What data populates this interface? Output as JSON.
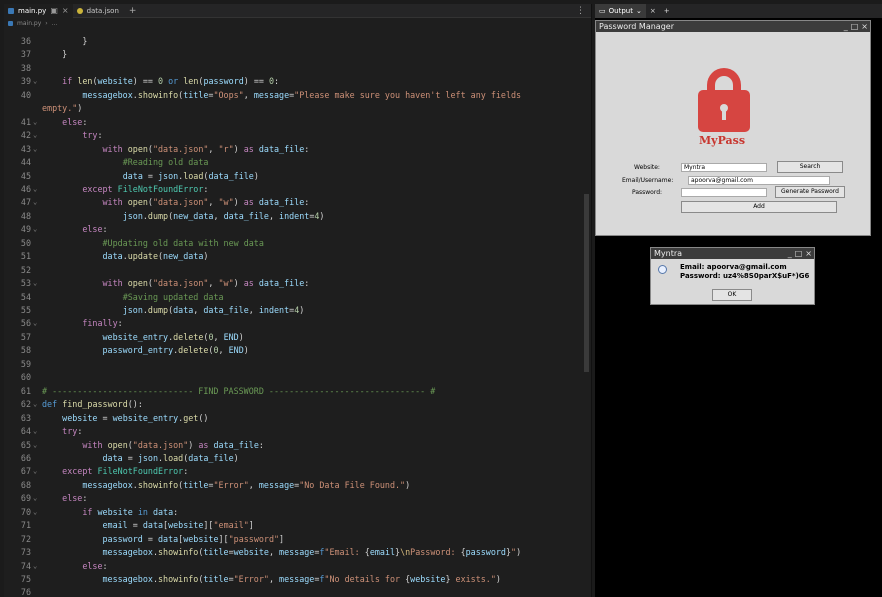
{
  "editor": {
    "tabs": [
      {
        "label": "main.py",
        "active": true
      },
      {
        "label": "data.json",
        "active": false
      }
    ],
    "breadcrumb": [
      "main.py",
      "..."
    ],
    "lines": [
      {
        "n": "36",
        "fold": false,
        "html": "        <span class='o'>}</span>"
      },
      {
        "n": "37",
        "fold": false,
        "html": "    <span class='o'>}</span>"
      },
      {
        "n": "38",
        "fold": false,
        "html": ""
      },
      {
        "n": "39",
        "fold": true,
        "html": "    <span class='kc'>if</span> <span class='f'>len</span>(<span class='v'>website</span>) == <span class='n'>0</span> <span class='k'>or</span> <span class='f'>len</span>(<span class='v'>password</span>) == <span class='n'>0</span>:"
      },
      {
        "n": "40",
        "fold": false,
        "html": "        <span class='v'>messagebox</span>.<span class='f'>showinfo</span>(<span class='v'>title</span>=<span class='s'>\"Oops\"</span>, <span class='v'>message</span>=<span class='s'>\"Please make sure you haven't left any fields</span>"
      },
      {
        "n": "",
        "fold": false,
        "html": "<span class='s'>empty.\"</span>)"
      },
      {
        "n": "41",
        "fold": true,
        "html": "    <span class='kc'>else</span>:"
      },
      {
        "n": "42",
        "fold": true,
        "html": "        <span class='kc'>try</span>:"
      },
      {
        "n": "43",
        "fold": true,
        "html": "            <span class='kc'>with</span> <span class='f'>open</span>(<span class='s'>\"data.json\"</span>, <span class='s'>\"r\"</span>) <span class='kc'>as</span> <span class='v'>data_file</span>:"
      },
      {
        "n": "44",
        "fold": false,
        "html": "                <span class='c'>#Reading old data</span>"
      },
      {
        "n": "45",
        "fold": false,
        "html": "                <span class='v'>data</span> = <span class='v'>json</span>.<span class='f'>load</span>(<span class='v'>data_file</span>)"
      },
      {
        "n": "46",
        "fold": true,
        "html": "        <span class='kc'>except</span> <span class='t'>FileNotFoundError</span>:"
      },
      {
        "n": "47",
        "fold": true,
        "html": "            <span class='kc'>with</span> <span class='f'>open</span>(<span class='s'>\"data.json\"</span>, <span class='s'>\"w\"</span>) <span class='kc'>as</span> <span class='v'>data_file</span>:"
      },
      {
        "n": "48",
        "fold": false,
        "html": "                <span class='v'>json</span>.<span class='f'>dump</span>(<span class='v'>new_data</span>, <span class='v'>data_file</span>, <span class='v'>indent</span>=<span class='n'>4</span>)"
      },
      {
        "n": "49",
        "fold": true,
        "html": "        <span class='kc'>else</span>:"
      },
      {
        "n": "50",
        "fold": false,
        "html": "            <span class='c'>#Updating old data with new data</span>"
      },
      {
        "n": "51",
        "fold": false,
        "html": "            <span class='v'>data</span>.<span class='f'>update</span>(<span class='v'>new_data</span>)"
      },
      {
        "n": "52",
        "fold": false,
        "html": ""
      },
      {
        "n": "53",
        "fold": true,
        "html": "            <span class='kc'>with</span> <span class='f'>open</span>(<span class='s'>\"data.json\"</span>, <span class='s'>\"w\"</span>) <span class='kc'>as</span> <span class='v'>data_file</span>:"
      },
      {
        "n": "54",
        "fold": false,
        "html": "                <span class='c'>#Saving updated data</span>"
      },
      {
        "n": "55",
        "fold": false,
        "html": "                <span class='v'>json</span>.<span class='f'>dump</span>(<span class='v'>data</span>, <span class='v'>data_file</span>, <span class='v'>indent</span>=<span class='n'>4</span>)"
      },
      {
        "n": "56",
        "fold": true,
        "html": "        <span class='kc'>finally</span>:"
      },
      {
        "n": "57",
        "fold": false,
        "html": "            <span class='v'>website_entry</span>.<span class='f'>delete</span>(<span class='n'>0</span>, <span class='v'>END</span>)"
      },
      {
        "n": "58",
        "fold": false,
        "html": "            <span class='v'>password_entry</span>.<span class='f'>delete</span>(<span class='n'>0</span>, <span class='v'>END</span>)"
      },
      {
        "n": "59",
        "fold": false,
        "html": ""
      },
      {
        "n": "60",
        "fold": false,
        "html": ""
      },
      {
        "n": "61",
        "fold": false,
        "html": "<span class='c'># ---------------------------- FIND PASSWORD ------------------------------- #</span>"
      },
      {
        "n": "62",
        "fold": true,
        "html": "<span class='k'>def</span> <span class='f'>find_password</span>():"
      },
      {
        "n": "63",
        "fold": false,
        "html": "    <span class='v'>website</span> = <span class='v'>website_entry</span>.<span class='f'>get</span>()"
      },
      {
        "n": "64",
        "fold": true,
        "html": "    <span class='kc'>try</span>:"
      },
      {
        "n": "65",
        "fold": true,
        "html": "        <span class='kc'>with</span> <span class='f'>open</span>(<span class='s'>\"data.json\"</span>) <span class='kc'>as</span> <span class='v'>data_file</span>:"
      },
      {
        "n": "66",
        "fold": false,
        "html": "            <span class='v'>data</span> = <span class='v'>json</span>.<span class='f'>load</span>(<span class='v'>data_file</span>)"
      },
      {
        "n": "67",
        "fold": true,
        "html": "    <span class='kc'>except</span> <span class='t'>FileNotFoundError</span>:"
      },
      {
        "n": "68",
        "fold": false,
        "html": "        <span class='v'>messagebox</span>.<span class='f'>showinfo</span>(<span class='v'>title</span>=<span class='s'>\"Error\"</span>, <span class='v'>message</span>=<span class='s'>\"No Data File Found.\"</span>)"
      },
      {
        "n": "69",
        "fold": true,
        "html": "    <span class='kc'>else</span>:"
      },
      {
        "n": "70",
        "fold": true,
        "html": "        <span class='kc'>if</span> <span class='v'>website</span> <span class='k'>in</span> <span class='v'>data</span>:"
      },
      {
        "n": "71",
        "fold": false,
        "html": "            <span class='v'>email</span> = <span class='v'>data</span>[<span class='v'>website</span>][<span class='s'>\"email\"</span>]"
      },
      {
        "n": "72",
        "fold": false,
        "html": "            <span class='v'>password</span> = <span class='v'>data</span>[<span class='v'>website</span>][<span class='s'>\"password\"</span>]"
      },
      {
        "n": "73",
        "fold": false,
        "html": "            <span class='v'>messagebox</span>.<span class='f'>showinfo</span>(<span class='v'>title</span>=<span class='v'>website</span>, <span class='v'>message</span>=<span class='k'>f</span><span class='s'>\"Email: </span>{<span class='v'>email</span>}<span class='e'>\\n</span><span class='s'>Password: </span>{<span class='v'>password</span>}<span class='s'>\"</span>)"
      },
      {
        "n": "74",
        "fold": true,
        "html": "        <span class='kc'>else</span>:"
      },
      {
        "n": "75",
        "fold": false,
        "html": "            <span class='v'>messagebox</span>.<span class='f'>showinfo</span>(<span class='v'>title</span>=<span class='s'>\"Error\"</span>, <span class='v'>message</span>=<span class='k'>f</span><span class='s'>\"No details for </span>{<span class='v'>website</span>}<span class='s'> exists.\"</span>)"
      },
      {
        "n": "76",
        "fold": false,
        "html": ""
      }
    ]
  },
  "output": {
    "tab_label": "Output",
    "pm_window": {
      "title": "Password Manager",
      "logo_text": "MyPass",
      "website_label": "Website:",
      "website_value": "Myntra",
      "email_label": "Email/Username:",
      "email_value": "apoorva@gmail.com",
      "password_label": "Password:",
      "password_value": "",
      "search_button": "Search",
      "generate_button": "Generate Password",
      "add_button": "Add"
    },
    "dialog": {
      "title": "Myntra",
      "email_line": "Email: apoorva@gmail.com",
      "password_line": "Password: uz4%8S0parX$uF*)G6",
      "ok_button": "OK"
    }
  }
}
